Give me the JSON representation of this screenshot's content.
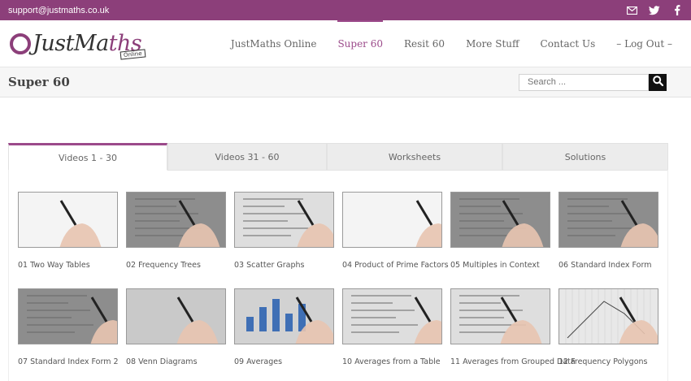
{
  "topbar": {
    "email": "support@justmaths.co.uk",
    "icons": [
      "envelope-icon",
      "twitter-icon",
      "facebook-icon"
    ],
    "color": "#8c3f7a"
  },
  "logo": {
    "word_a": "JustMa",
    "word_b": "ths",
    "tag": "Online"
  },
  "nav": [
    {
      "label": "JustMaths Online",
      "active": false
    },
    {
      "label": "Super 60",
      "active": true
    },
    {
      "label": "Resit 60",
      "active": false
    },
    {
      "label": "More Stuff",
      "active": false
    },
    {
      "label": "Contact Us",
      "active": false
    },
    {
      "label": "– Log Out –",
      "active": false
    }
  ],
  "page": {
    "title": "Super 60",
    "search_placeholder": "Search ..."
  },
  "tabs": [
    {
      "label": "Videos 1 - 30",
      "active": true
    },
    {
      "label": "Videos 31 - 60",
      "active": false
    },
    {
      "label": "Worksheets",
      "active": false
    },
    {
      "label": "Solutions",
      "active": false
    }
  ],
  "videos": [
    {
      "caption": "01 Two Way Tables",
      "scene": "white"
    },
    {
      "caption": "02 Frequency Trees",
      "scene": "grey"
    },
    {
      "caption": "03 Scatter Graphs",
      "scene": "paper"
    },
    {
      "caption": "04 Product of Prime Factors",
      "scene": "white"
    },
    {
      "caption": "05 Multiples in Context",
      "scene": "grey"
    },
    {
      "caption": "06 Standard Index Form",
      "scene": "grey"
    },
    {
      "caption": "07 Standard Index Form 2",
      "scene": "grey"
    },
    {
      "caption": "08 Venn Diagrams",
      "scene": "light"
    },
    {
      "caption": "09 Averages",
      "scene": "chart"
    },
    {
      "caption": "10 Averages from a Table",
      "scene": "paper"
    },
    {
      "caption": "11 Averages from Grouped Data",
      "scene": "paper"
    },
    {
      "caption": "12 Frequency Polygons",
      "scene": "graph"
    }
  ],
  "colors": {
    "brand": "#8c3f7a",
    "accent": "#9b4a8a"
  }
}
